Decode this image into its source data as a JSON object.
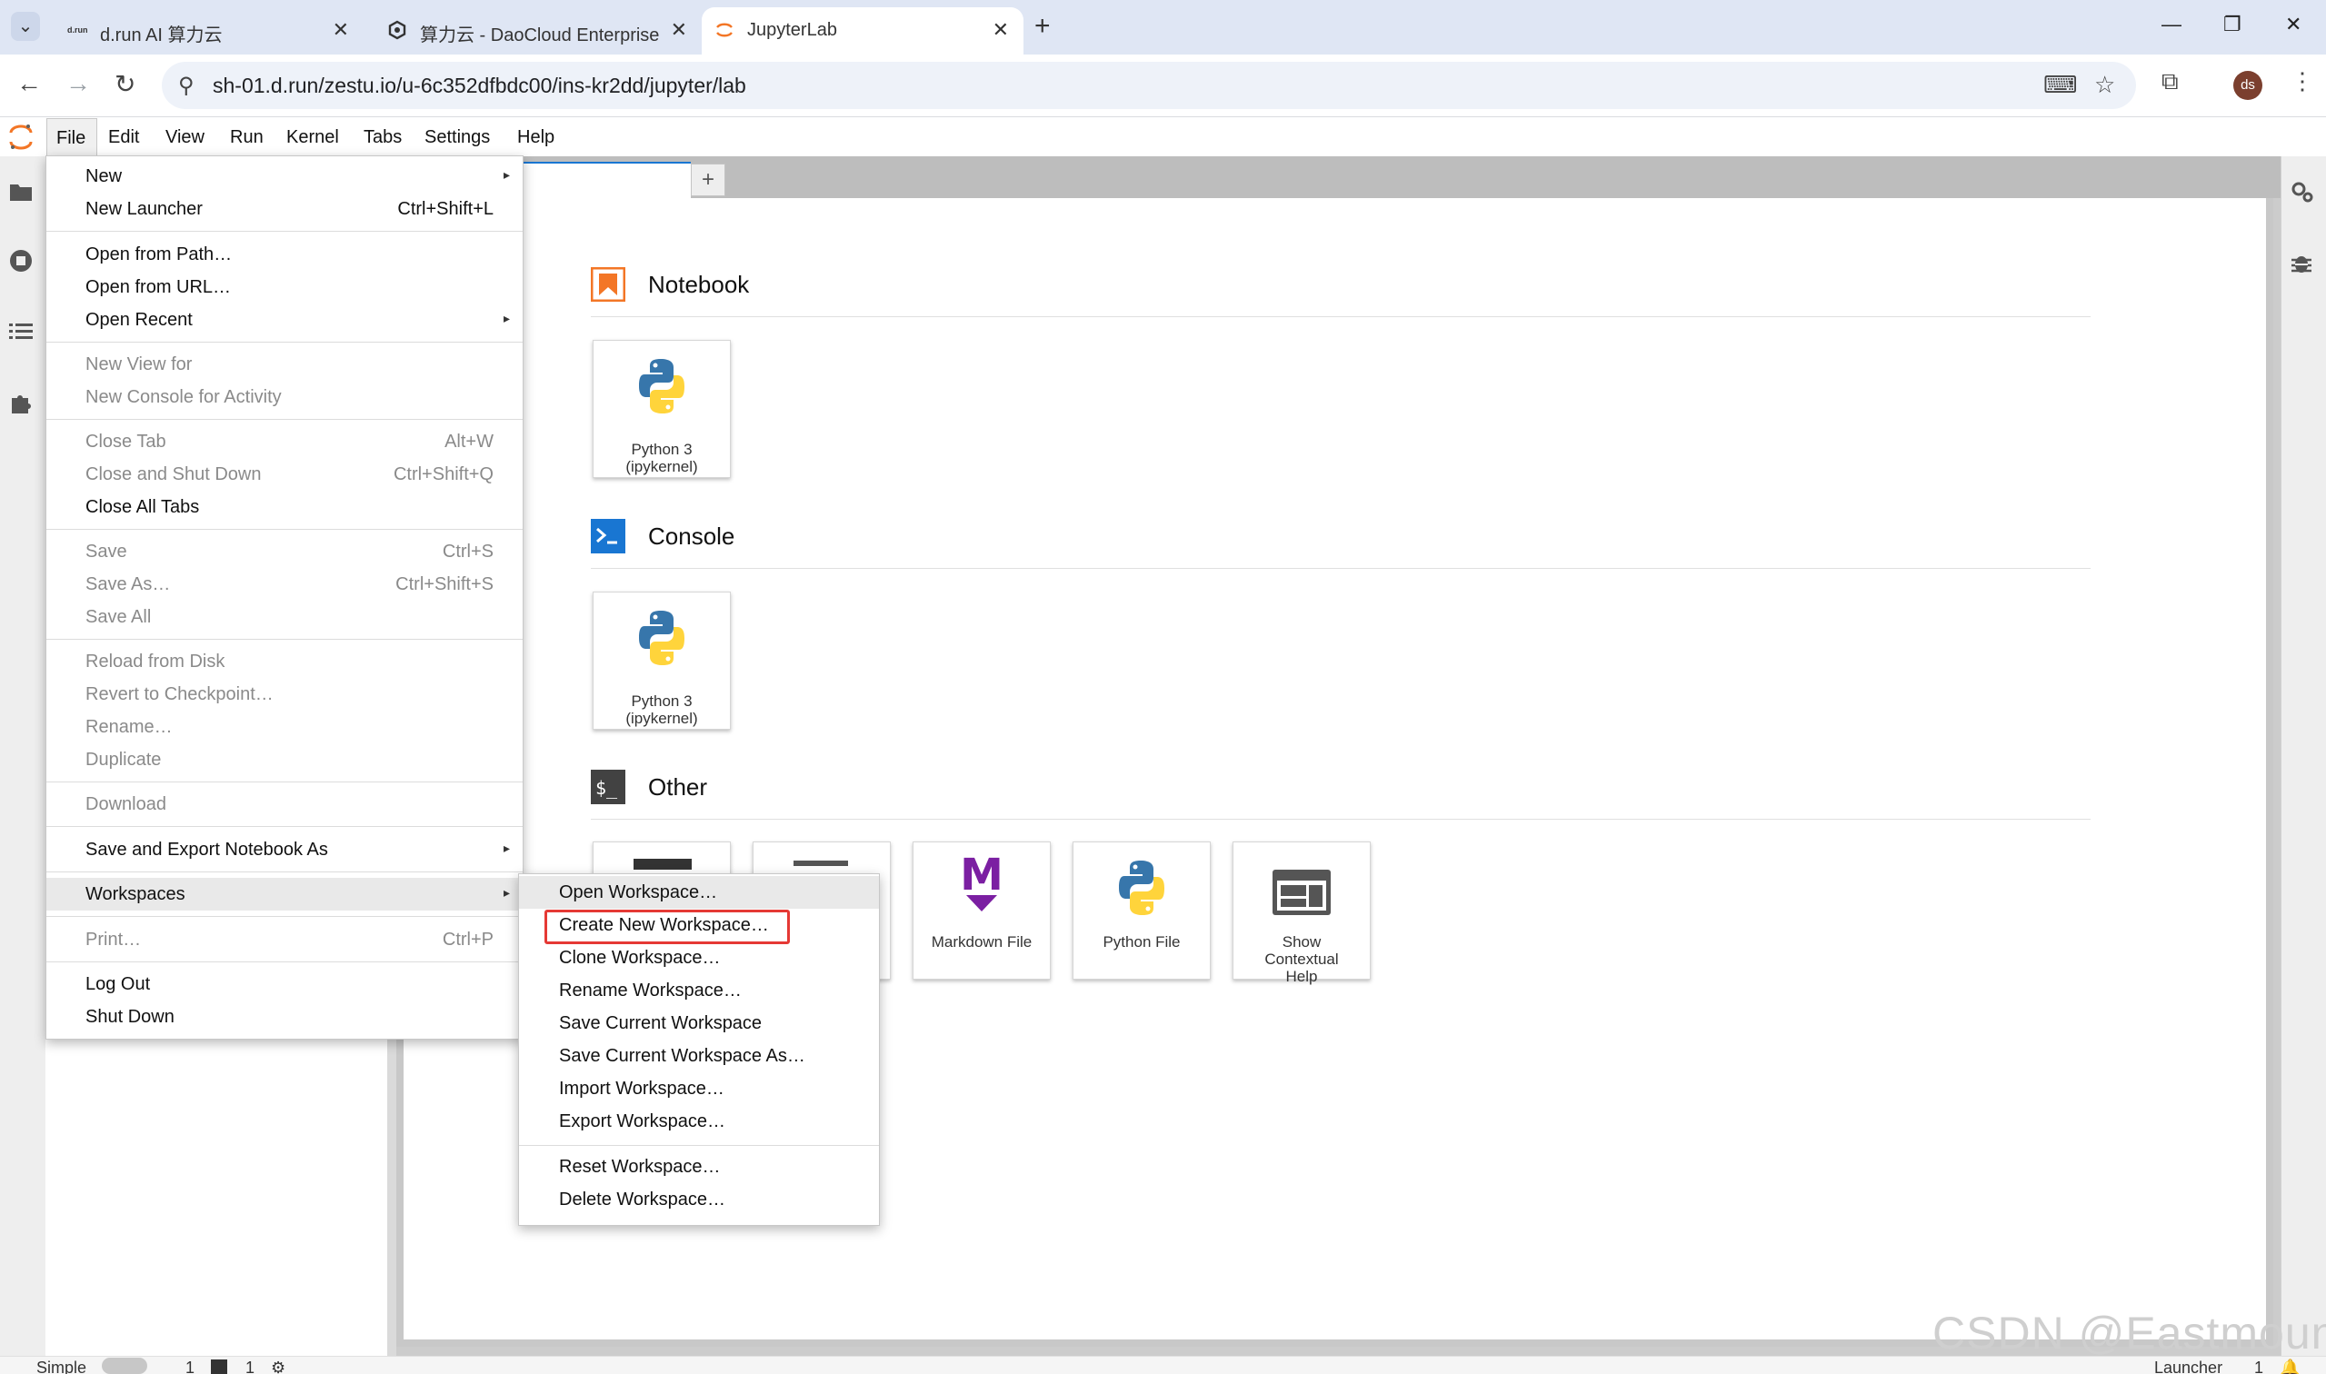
{
  "browser": {
    "tabs": [
      {
        "title": "d.run AI 算力云",
        "favicon": "d.run"
      },
      {
        "title": "算力云 - DaoCloud Enterprise",
        "favicon": "daocloud-icon"
      },
      {
        "title": "JupyterLab",
        "favicon": "jupyter-icon"
      }
    ],
    "url": "sh-01.d.run/zestu.io/u-6c352dfbdc00/ins-kr2dd/jupyter/lab",
    "avatar_initials": "ds"
  },
  "menubar": {
    "items": [
      "File",
      "Edit",
      "View",
      "Run",
      "Kernel",
      "Tabs",
      "Settings",
      "Help"
    ]
  },
  "file_menu": {
    "items": [
      {
        "label": "New",
        "submenu": true
      },
      {
        "label": "New Launcher",
        "shortcut": "Ctrl+Shift+L"
      },
      {
        "label": "Open from Path…"
      },
      {
        "label": "Open from URL…"
      },
      {
        "label": "Open Recent",
        "submenu": true
      },
      {
        "label": "New View for",
        "disabled": true
      },
      {
        "label": "New Console for Activity",
        "disabled": true
      },
      {
        "label": "Close Tab",
        "shortcut": "Alt+W",
        "disabled": true
      },
      {
        "label": "Close and Shut Down",
        "shortcut": "Ctrl+Shift+Q",
        "disabled": true
      },
      {
        "label": "Close All Tabs"
      },
      {
        "label": "Save",
        "shortcut": "Ctrl+S",
        "disabled": true
      },
      {
        "label": "Save As…",
        "shortcut": "Ctrl+Shift+S",
        "disabled": true
      },
      {
        "label": "Save All",
        "disabled": true
      },
      {
        "label": "Reload from Disk",
        "disabled": true
      },
      {
        "label": "Revert to Checkpoint…",
        "disabled": true
      },
      {
        "label": "Rename…",
        "disabled": true
      },
      {
        "label": "Duplicate",
        "disabled": true
      },
      {
        "label": "Download",
        "disabled": true
      },
      {
        "label": "Save and Export Notebook As",
        "submenu": true
      },
      {
        "label": "Workspaces",
        "submenu": true,
        "highlighted": true
      },
      {
        "label": "Print…",
        "shortcut": "Ctrl+P",
        "disabled": true
      },
      {
        "label": "Log Out"
      },
      {
        "label": "Shut Down"
      }
    ]
  },
  "workspaces_menu": {
    "items": [
      {
        "label": "Open Workspace…"
      },
      {
        "label": "Create New Workspace…",
        "annotated": true
      },
      {
        "label": "Clone Workspace…"
      },
      {
        "label": "Rename Workspace…"
      },
      {
        "label": "Save Current Workspace"
      },
      {
        "label": "Save Current Workspace As…"
      },
      {
        "label": "Import Workspace…"
      },
      {
        "label": "Export Workspace…"
      },
      {
        "label": "Reset Workspace…"
      },
      {
        "label": "Delete Workspace…"
      }
    ]
  },
  "launcher": {
    "sections": [
      {
        "title": "Notebook",
        "cards": [
          {
            "label": "Python 3\n(ipykernel)",
            "icon": "python-icon"
          }
        ]
      },
      {
        "title": "Console",
        "cards": [
          {
            "label": "Python 3\n(ipykernel)",
            "icon": "python-icon"
          }
        ]
      },
      {
        "title": "Other",
        "cards": [
          {
            "label": "Markdown File",
            "icon": "markdown-icon"
          },
          {
            "label": "Python File",
            "icon": "python-icon"
          },
          {
            "label": "Show\nContextual\nHelp",
            "icon": "contextual-help-icon"
          }
        ]
      }
    ]
  },
  "statusbar": {
    "mode": "Simple",
    "count_a": "1",
    "count_b": "1",
    "right_label": "Launcher",
    "right_count": "1"
  },
  "watermark": "CSDN @Eastmount",
  "colors": {
    "accent": "#1976d2",
    "jupyter_orange": "#f37626",
    "annotation_red": "#e53935",
    "markdown_purple": "#7b1fa2"
  }
}
